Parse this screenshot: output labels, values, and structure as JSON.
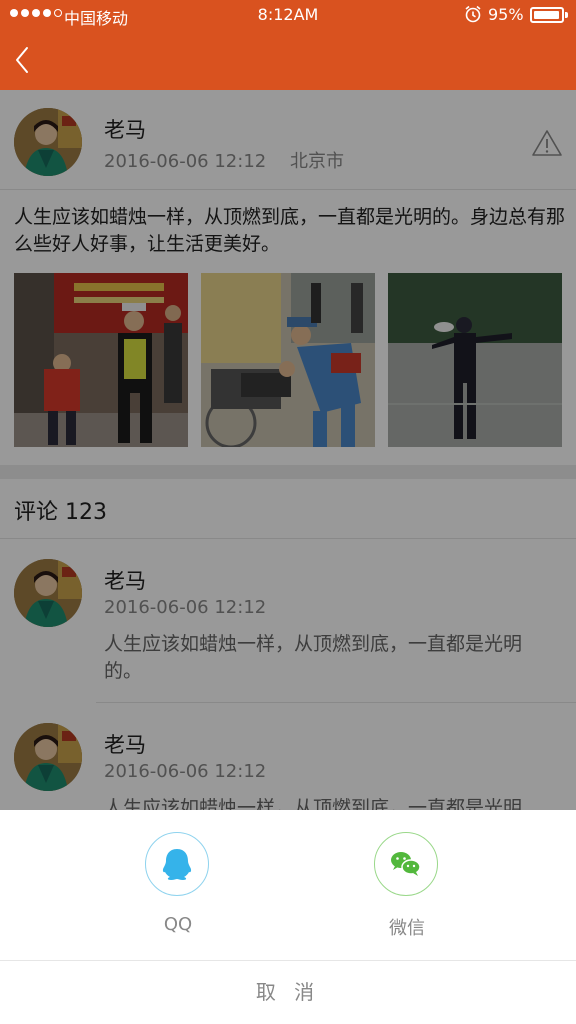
{
  "statusbar": {
    "carrier": "中国移动",
    "time": "8:12AM",
    "battery_percent": "95%",
    "battery_level": 0.95,
    "signal_bars_filled": 4,
    "signal_bars_total": 5,
    "alarm_icon": "alarm-clock-icon"
  },
  "navbar": {
    "back_icon": "chevron-left-icon",
    "color": "#d9521f"
  },
  "post": {
    "author": "老马",
    "date": "2016-06-06",
    "time": "12:12",
    "location": "北京市",
    "report_icon": "warning-triangle-icon",
    "text": "人生应该如蜡烛一样，从顶燃到底，一直都是光明的。身边总有那么些好人好事，让生活更美好。",
    "photo_count": 3
  },
  "comments": {
    "title": "评论 123",
    "items": [
      {
        "author": "老马",
        "date": "2016-06-06",
        "time": "12:12",
        "text": "人生应该如蜡烛一样，从顶燃到底，一直都是光明的。"
      },
      {
        "author": "老马",
        "date": "2016-06-06",
        "time": "12:12",
        "text": "人生应该如蜡烛一样，从顶燃到底，一直都是光明的。"
      }
    ]
  },
  "share_sheet": {
    "options": [
      {
        "label": "QQ",
        "icon": "qq-penguin-icon",
        "color": "#35b3ea"
      },
      {
        "label": "微信",
        "icon": "wechat-icon",
        "color": "#52b83c"
      }
    ],
    "cancel_label": "取 消"
  }
}
